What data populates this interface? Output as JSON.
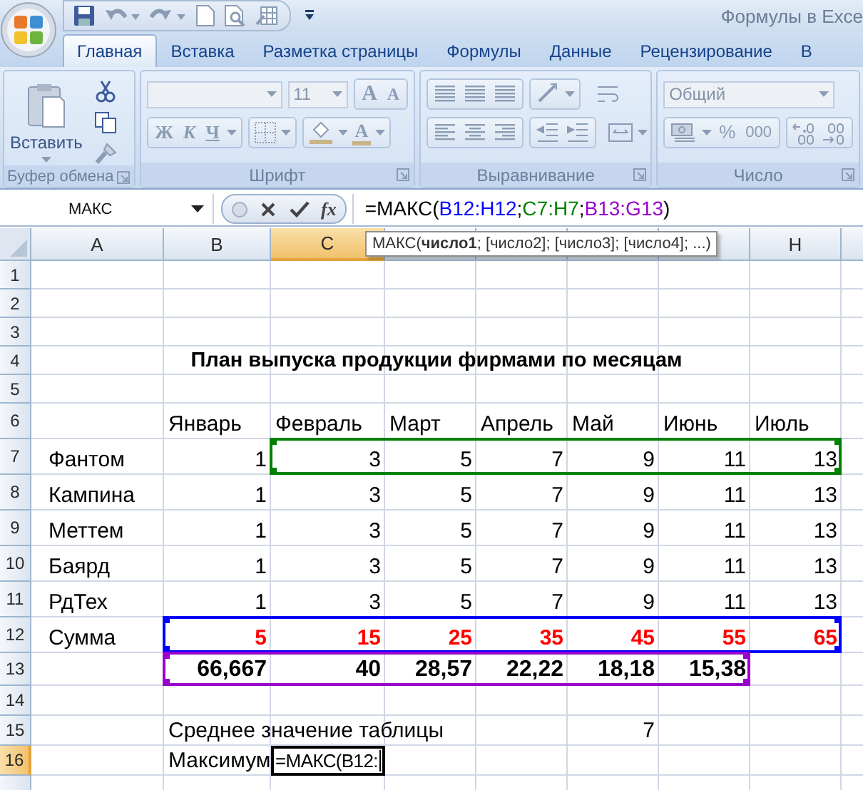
{
  "window": {
    "title": "Формулы в Exce"
  },
  "tabs": [
    {
      "label": "Главная",
      "selected": true
    },
    {
      "label": "Вставка",
      "selected": false
    },
    {
      "label": "Разметка страницы",
      "selected": false
    },
    {
      "label": "Формулы",
      "selected": false
    },
    {
      "label": "Данные",
      "selected": false
    },
    {
      "label": "Рецензирование",
      "selected": false
    },
    {
      "label": "В",
      "selected": false
    }
  ],
  "ribbon": {
    "disabled": true,
    "groups": [
      {
        "kind": "clipboard",
        "label": "Буфер обмена",
        "paste_label": "Вставить"
      },
      {
        "kind": "font",
        "label": "Шрифт",
        "font_size": "11",
        "size_buttons": [
          "A",
          "A"
        ],
        "style_buttons": [
          "Ж",
          "К",
          "Ч"
        ],
        "color_letter": "A"
      },
      {
        "kind": "alignment",
        "label": "Выравнивание"
      },
      {
        "kind": "number",
        "label": "Число",
        "format": "Общий",
        "percent": "%",
        "thousands": "000"
      }
    ]
  },
  "formula_bar": {
    "name_box": "МАКС",
    "function_button": "fx",
    "parts": [
      {
        "text": "=МАКС(",
        "color": "#000000"
      },
      {
        "text": "B12:H12",
        "color": "#0000ff"
      },
      {
        "text": ";",
        "color": "#000000"
      },
      {
        "text": "C7:H7",
        "color": "#008000"
      },
      {
        "text": ";",
        "color": "#000000"
      },
      {
        "text": "B13:G13",
        "color": "#9900cc"
      },
      {
        "text": ")",
        "color": "#000000"
      }
    ],
    "tooltip": "МАКС(**число1**; [число2]; [число3]; [число4]; ...)"
  },
  "sheet": {
    "columns": [
      {
        "label": "A",
        "selected": false
      },
      {
        "label": "B",
        "selected": false
      },
      {
        "label": "C",
        "selected": true
      },
      {
        "selected": false
      },
      {
        "selected": false
      },
      {
        "selected": false
      },
      {
        "selected": false
      },
      {
        "label": "H",
        "selected": false
      }
    ],
    "rows": [
      {
        "number": "1",
        "selected": false
      },
      {
        "number": "2",
        "selected": false
      },
      {
        "number": "3",
        "selected": false
      },
      {
        "number": "4",
        "selected": false,
        "kind": "title",
        "cells": [
          {
            "text": "План выпуска продукции фирмами по месяцам"
          },
          null,
          null,
          null,
          null,
          null,
          null,
          null
        ]
      },
      {
        "number": "5",
        "selected": false
      },
      {
        "number": "6",
        "selected": false,
        "kind": "header",
        "cells": [
          null,
          {
            "text": "Январь"
          },
          {
            "text": "Февраль"
          },
          {
            "text": "Март"
          },
          {
            "text": "Апрель"
          },
          {
            "text": "Май"
          },
          {
            "text": "Июнь"
          },
          {
            "text": "Июль"
          }
        ]
      },
      {
        "number": "7",
        "selected": false,
        "kind": "data",
        "highlight": {
          "color": "#008000"
        },
        "cells": [
          {
            "text": "Фантом",
            "in_range": false
          },
          {
            "text": "1",
            "in_range": false
          },
          {
            "text": "3",
            "in_range": true
          },
          {
            "text": "5",
            "in_range": true
          },
          {
            "text": "7",
            "in_range": true
          },
          {
            "text": "9",
            "in_range": true
          },
          {
            "text": "11",
            "in_range": true
          },
          {
            "text": "13",
            "in_range": true
          }
        ]
      },
      {
        "number": "8",
        "selected": false,
        "kind": "data",
        "cells": [
          {
            "text": "Кампина"
          },
          {
            "text": "1"
          },
          {
            "text": "3"
          },
          {
            "text": "5"
          },
          {
            "text": "7"
          },
          {
            "text": "9"
          },
          {
            "text": "11"
          },
          {
            "text": "13"
          }
        ]
      },
      {
        "number": "9",
        "selected": false,
        "kind": "data",
        "cells": [
          {
            "text": "Меттем"
          },
          {
            "text": "1"
          },
          {
            "text": "3"
          },
          {
            "text": "5"
          },
          {
            "text": "7"
          },
          {
            "text": "9"
          },
          {
            "text": "11"
          },
          {
            "text": "13"
          }
        ]
      },
      {
        "number": "10",
        "selected": false,
        "kind": "data",
        "cells": [
          {
            "text": "Баярд"
          },
          {
            "text": "1"
          },
          {
            "text": "3"
          },
          {
            "text": "5"
          },
          {
            "text": "7"
          },
          {
            "text": "9"
          },
          {
            "text": "11"
          },
          {
            "text": "13"
          }
        ]
      },
      {
        "number": "11",
        "selected": false,
        "kind": "data",
        "cells": [
          {
            "text": "РдТех"
          },
          {
            "text": "1"
          },
          {
            "text": "3"
          },
          {
            "text": "5"
          },
          {
            "text": "7"
          },
          {
            "text": "9"
          },
          {
            "text": "11"
          },
          {
            "text": "13"
          }
        ]
      },
      {
        "number": "12",
        "selected": false,
        "kind": "sum",
        "highlight": {
          "color": "#0000ff"
        },
        "cells": [
          {
            "text": "Сумма",
            "in_range": false
          },
          {
            "text": "5",
            "in_range": true
          },
          {
            "text": "15",
            "in_range": true
          },
          {
            "text": "25",
            "in_range": true
          },
          {
            "text": "35",
            "in_range": true
          },
          {
            "text": "45",
            "in_range": true
          },
          {
            "text": "55",
            "in_range": true
          },
          {
            "text": "65",
            "in_range": true
          }
        ]
      },
      {
        "number": "13",
        "selected": false,
        "kind": "ratio",
        "highlight": {
          "color": "#9900cc"
        },
        "cells": [
          null,
          {
            "text": "66,667",
            "in_range": true
          },
          {
            "text": "40",
            "in_range": true
          },
          {
            "text": "28,57",
            "in_range": true
          },
          {
            "text": "22,22",
            "in_range": true
          },
          {
            "text": "18,18",
            "in_range": true
          },
          {
            "text": "15,38",
            "in_range": true
          },
          null
        ]
      },
      {
        "number": "14",
        "selected": false
      },
      {
        "number": "15",
        "selected": false,
        "kind": "note",
        "cells": [
          null,
          {
            "text": "Среднее значение таблицы"
          },
          null,
          null,
          null,
          {
            "text": "7"
          },
          null,
          null
        ]
      },
      {
        "number": "16",
        "selected": true,
        "kind": "input",
        "cells": [
          null,
          {
            "text": "Максимум"
          },
          {
            "text": "=МАКС(B12:"
          },
          null,
          null,
          null,
          null,
          null
        ]
      }
    ]
  }
}
